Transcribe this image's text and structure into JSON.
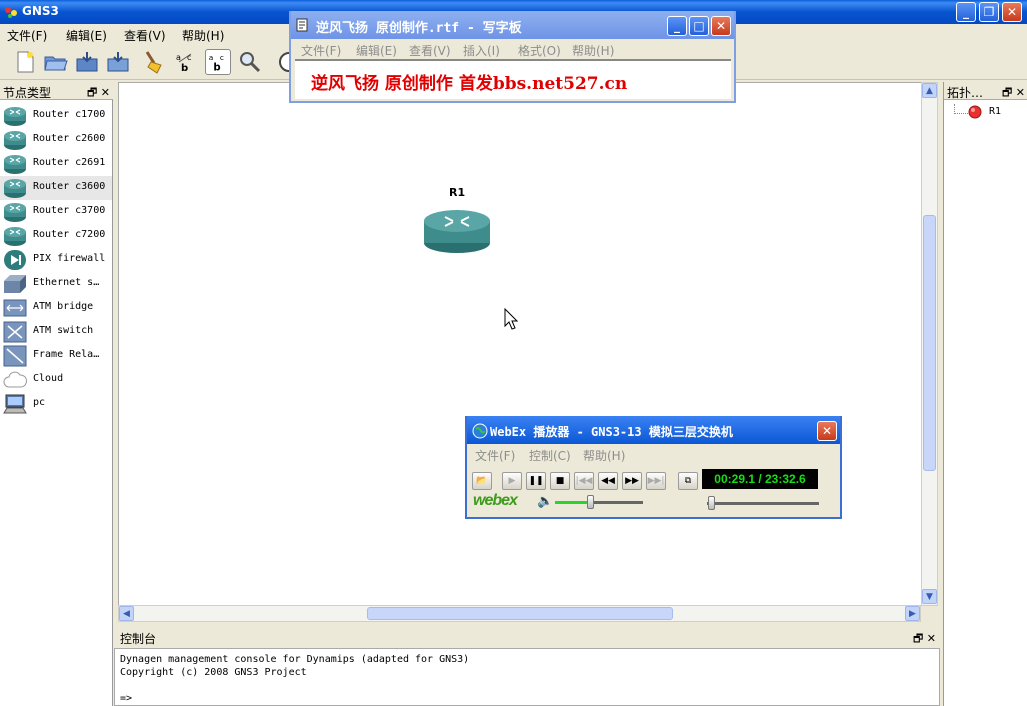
{
  "window": {
    "title": "GNS3",
    "min_label": "_",
    "max_label": "❐",
    "close_label": "✕"
  },
  "menu": {
    "file": "文件(F)",
    "edit": "编辑(E)",
    "view": "查看(V)",
    "help": "帮助(H)"
  },
  "left_panel": {
    "title": "节点类型",
    "float": "🗗",
    "close": "✕",
    "nodes": [
      {
        "label": "Router c1700",
        "icon": "router-icon"
      },
      {
        "label": "Router c2600",
        "icon": "router-icon"
      },
      {
        "label": "Router c2691",
        "icon": "router-icon"
      },
      {
        "label": "Router c3600",
        "icon": "router-icon"
      },
      {
        "label": "Router c3700",
        "icon": "router-icon"
      },
      {
        "label": "Router c7200",
        "icon": "router-icon"
      },
      {
        "label": "PIX firewall",
        "icon": "firewall-icon"
      },
      {
        "label": "Ethernet s…",
        "icon": "ethernet-switch-icon"
      },
      {
        "label": "ATM bridge",
        "icon": "atm-bridge-icon"
      },
      {
        "label": "ATM switch",
        "icon": "atm-switch-icon"
      },
      {
        "label": "Frame Rela…",
        "icon": "frame-relay-icon"
      },
      {
        "label": "Cloud",
        "icon": "cloud-icon"
      },
      {
        "label": "pc",
        "icon": "pc-icon"
      }
    ],
    "selected_index": 3
  },
  "canvas": {
    "device_label": "R1"
  },
  "right_panel": {
    "title": "拓扑…",
    "float": "🗗",
    "close": "✕",
    "items": [
      {
        "label": "R1"
      }
    ]
  },
  "console": {
    "title": "控制台",
    "float": "🗗",
    "close": "✕",
    "lines": [
      "Dynagen management console for Dynamips (adapted for GNS3)",
      "Copyright (c) 2008 GNS3 Project",
      "",
      "=>"
    ]
  },
  "wordpad": {
    "title": "逆风飞扬 原创制作.rtf - 写字板",
    "menu": [
      "文件(F)",
      "编辑(E)",
      "查看(V)",
      "插入(I)",
      "格式(O)",
      "帮助(H)"
    ],
    "content": "逆风飞扬 原创制作 首发bbs.net527.cn"
  },
  "webex": {
    "title": "WebEx 播放器 - GNS3-13 模拟三层交换机",
    "menu": [
      "文件(F)",
      "控制(C)",
      "帮助(H)"
    ],
    "time": "00:29.1 / 23:32.6",
    "brand": "webex",
    "volume_level": 0.4,
    "playback_progress": 0.021
  },
  "colors": {
    "xp_blue": "#0854d0",
    "wordpad_text": "#e00000",
    "timer_green": "#15e015"
  }
}
